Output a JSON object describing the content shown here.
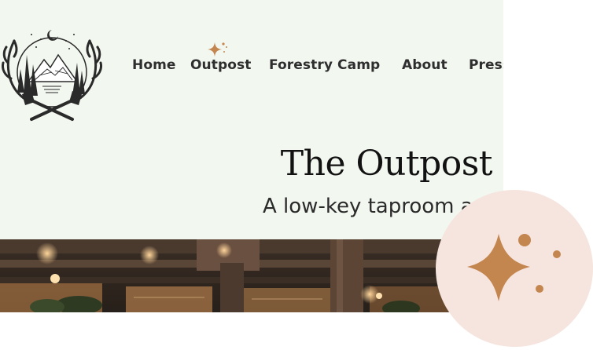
{
  "nav": {
    "items": [
      {
        "label": "Home"
      },
      {
        "label": "Outpost"
      },
      {
        "label": "Forestry Camp"
      },
      {
        "label": "About"
      },
      {
        "label": "Press"
      }
    ],
    "active_index": 1
  },
  "hero": {
    "title": "The Outpost",
    "subtitle": "A low-key taproom an"
  },
  "icons": {
    "logo": "antler-crest-logo",
    "nav_active": "sparkle-icon",
    "badge": "sparkle-icon"
  },
  "colors": {
    "background": "#f2f7f0",
    "accent": "#c4864f",
    "badge_bg": "#f6e4de",
    "text": "#2e2e2e"
  }
}
